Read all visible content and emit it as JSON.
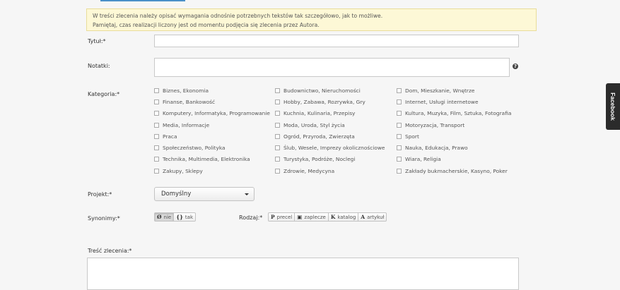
{
  "notice": {
    "line1": "W treści zlecenia należy opisać wymagania odnośnie potrzebnych tekstów tak szczegółowo, jak to możliwe.",
    "line2": "Pamiętaj, czas realizacji liczony jest od momentu podjęcia się zlecenia przez Autora."
  },
  "form": {
    "title_label": "Tytuł:*",
    "title_value": "",
    "notes_label": "Notatki:",
    "notes_value": "",
    "help_icon": "?",
    "category_label": "Kategoria:*",
    "project_label": "Projekt:*",
    "project_value": "Domyślny",
    "synonyms_label": "Synonimy:*",
    "type_label": "Rodzaj:*",
    "content_label": "Treść zlecenia:*"
  },
  "categories": {
    "col1": [
      "Biznes, Ekonomia",
      "Finanse, Bankowość",
      "Komputery, Informatyka, Programowanie",
      "Media, Informacje",
      "Praca",
      "Społeczeństwo, Polityka",
      "Technika, Multimedia, Elektronika",
      "Zakupy, Sklepy"
    ],
    "col2": [
      "Budownictwo, Nieruchomości",
      "Hobby, Zabawa, Rozrywka, Gry",
      "Kuchnia, Kulinaria, Przepisy",
      "Moda, Uroda, Styl życia",
      "Ogród, Przyroda, Zwierzęta",
      "Ślub, Wesele, Imprezy okolicznościowe",
      "Turystyka, Podróże, Noclegi",
      "Zdrowie, Medycyna"
    ],
    "col3": [
      "Dom, Mieszkanie, Wnętrze",
      "Internet, Usługi internetowe",
      "Kultura, Muzyka, Film, Sztuka, Fotografia",
      "Motoryzacja, Transport",
      "Sport",
      "Nauka, Edukacja, Prawo",
      "Wiara, Religia",
      "Zakłady bukmacherskie, Kasyno, Poker"
    ]
  },
  "synonyms": {
    "no_icon": "Ø",
    "no_label": "nie",
    "yes_icon": "{}",
    "yes_label": "tak"
  },
  "types": [
    {
      "icon": "P",
      "label": "precel"
    },
    {
      "icon": "▣",
      "label": "zaplecze"
    },
    {
      "icon": "K",
      "label": "katalog"
    },
    {
      "icon": "A",
      "label": "artykuł"
    }
  ],
  "facebook_tab": "Facebook"
}
